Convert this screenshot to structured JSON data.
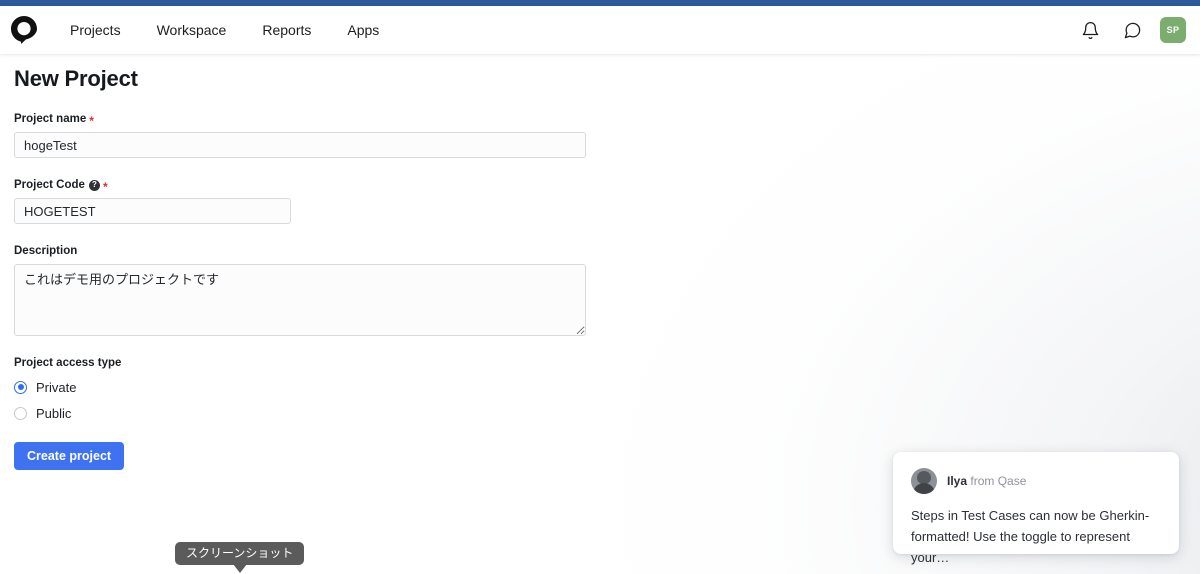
{
  "topbar": {
    "accent_color": "#2c5a9a"
  },
  "header": {
    "logo_name": "qase-logo",
    "nav": [
      {
        "label": "Projects"
      },
      {
        "label": "Workspace"
      },
      {
        "label": "Reports"
      },
      {
        "label": "Apps"
      }
    ],
    "notifications_icon": "bell-icon",
    "messages_icon": "chat-bubble-icon",
    "avatar_initials": "SP",
    "avatar_color": "#7aad6e"
  },
  "page": {
    "title": "New Project"
  },
  "form": {
    "project_name": {
      "label": "Project name",
      "required_marker": "*",
      "value": "hogeTest",
      "placeholder": ""
    },
    "project_code": {
      "label": "Project Code",
      "help_glyph": "?",
      "required_marker": "*",
      "value": "HOGETEST",
      "placeholder": ""
    },
    "description": {
      "label": "Description",
      "value": "これはデモ用のプロジェクトです",
      "placeholder": ""
    },
    "access_type": {
      "label": "Project access type",
      "options": [
        {
          "label": "Private",
          "selected": true
        },
        {
          "label": "Public",
          "selected": false
        }
      ]
    },
    "submit_label": "Create project",
    "submit_color": "#3e72f0"
  },
  "notification": {
    "sender_name": "Ilya",
    "sender_suffix": "from Qase",
    "message": "Steps in Test Cases can now be Gherkin-formatted! Use the toggle to represent your…"
  },
  "tooltip": {
    "text": "スクリーンショット"
  }
}
